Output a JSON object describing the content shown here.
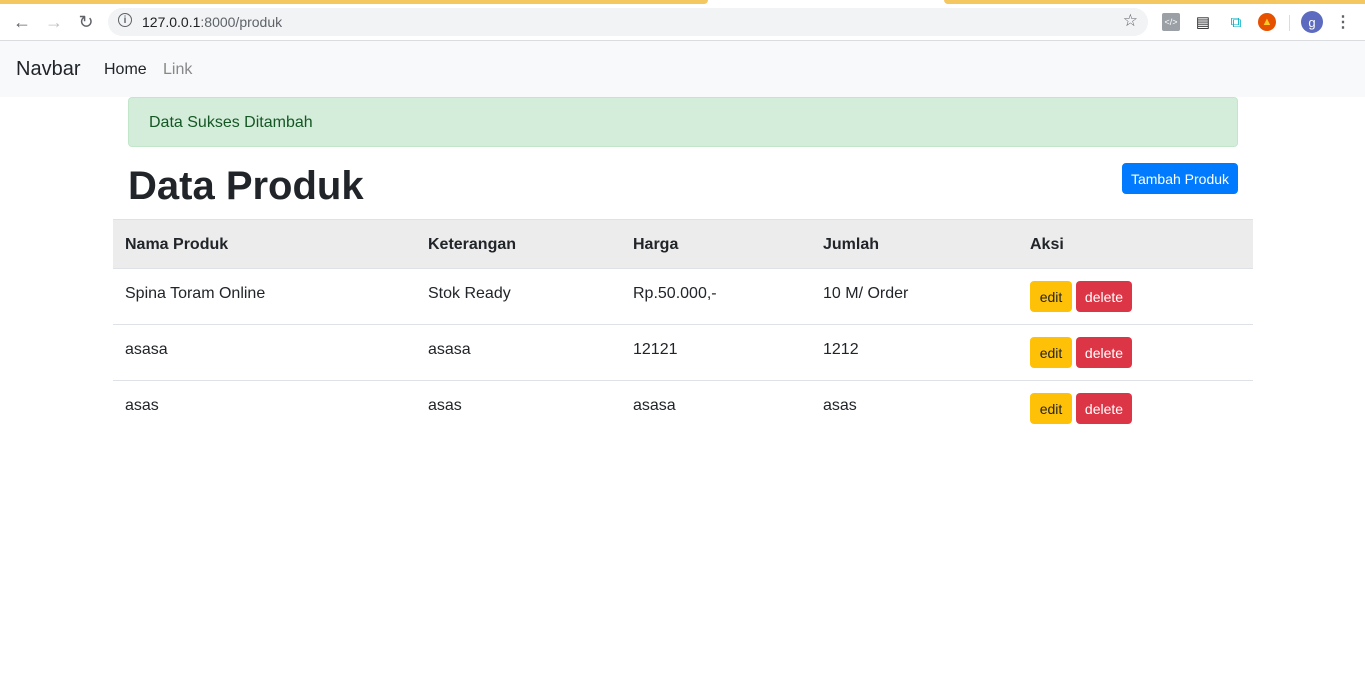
{
  "browser": {
    "url_host": "127.0.0.1",
    "url_path": ":8000/produk",
    "avatar_initial": "g"
  },
  "navbar": {
    "brand": "Navbar",
    "home": "Home",
    "link": "Link"
  },
  "alert": {
    "message": "Data Sukses Ditambah"
  },
  "page": {
    "title": "Data Produk",
    "add_button": "Tambah Produk"
  },
  "table": {
    "headers": [
      "Nama Produk",
      "Keterangan",
      "Harga",
      "Jumlah",
      "Aksi"
    ],
    "rows": [
      {
        "nama": "Spina Toram Online",
        "keterangan": "Stok Ready",
        "harga": "Rp.50.000,-",
        "jumlah": "10 M/ Order",
        "edit": "edit",
        "delete": "delete"
      },
      {
        "nama": "asasa",
        "keterangan": "asasa",
        "harga": "12121",
        "jumlah": "1212",
        "edit": "edit",
        "delete": "delete"
      },
      {
        "nama": "asas",
        "keterangan": "asas",
        "harga": "asasa",
        "jumlah": "asas",
        "edit": "edit",
        "delete": "delete"
      }
    ]
  },
  "colors": {
    "primary": "#007bff",
    "warning": "#ffc107",
    "danger": "#dc3545",
    "success_bg": "#d4edda",
    "success_text": "#155724"
  }
}
